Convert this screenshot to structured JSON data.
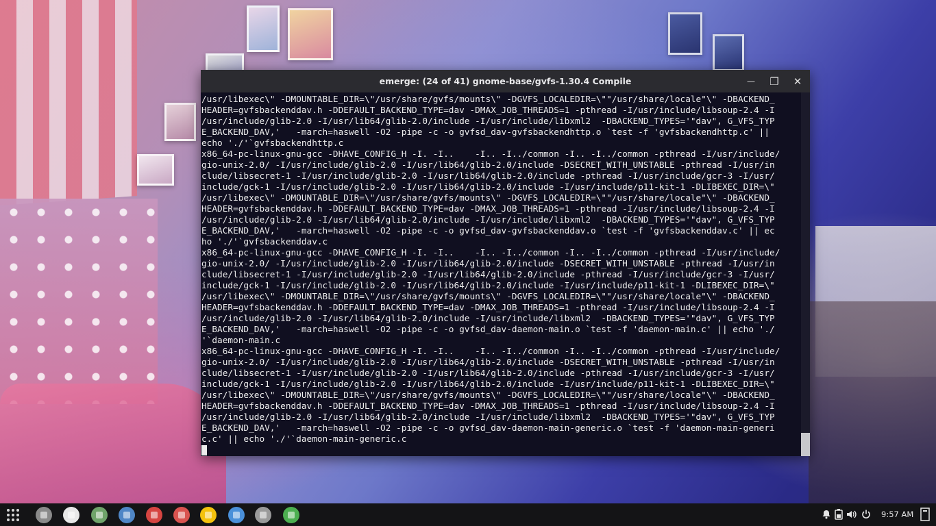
{
  "window": {
    "title": "emerge: (24 of 41) gnome-base/gvfs-1.30.4 Compile",
    "minimize_glyph": "—",
    "maximize_glyph": "❐",
    "close_glyph": "✕"
  },
  "terminal": {
    "lines": [
      "/usr/libexec\\\" -DMOUNTABLE_DIR=\\\"/usr/share/gvfs/mounts\\\" -DGVFS_LOCALEDIR=\\\"\"/usr/share/locale\"\\\" -DBACKEND_",
      "HEADER=gvfsbackenddav.h -DDEFAULT_BACKEND_TYPE=dav -DMAX_JOB_THREADS=1 -pthread -I/usr/include/libsoup-2.4 -I",
      "/usr/include/glib-2.0 -I/usr/lib64/glib-2.0/include -I/usr/include/libxml2  -DBACKEND_TYPES='\"dav\", G_VFS_TYP",
      "E_BACKEND_DAV,'   -march=haswell -O2 -pipe -c -o gvfsd_dav-gvfsbackendhttp.o `test -f 'gvfsbackendhttp.c' ||",
      "echo './'`gvfsbackendhttp.c",
      "x86_64-pc-linux-gnu-gcc -DHAVE_CONFIG_H -I. -I..    -I.. -I../common -I.. -I../common -pthread -I/usr/include/",
      "gio-unix-2.0/ -I/usr/include/glib-2.0 -I/usr/lib64/glib-2.0/include -DSECRET_WITH_UNSTABLE -pthread -I/usr/in",
      "clude/libsecret-1 -I/usr/include/glib-2.0 -I/usr/lib64/glib-2.0/include -pthread -I/usr/include/gcr-3 -I/usr/",
      "include/gck-1 -I/usr/include/glib-2.0 -I/usr/lib64/glib-2.0/include -I/usr/include/p11-kit-1 -DLIBEXEC_DIR=\\\"",
      "/usr/libexec\\\" -DMOUNTABLE_DIR=\\\"/usr/share/gvfs/mounts\\\" -DGVFS_LOCALEDIR=\\\"\"/usr/share/locale\"\\\" -DBACKEND_",
      "HEADER=gvfsbackenddav.h -DDEFAULT_BACKEND_TYPE=dav -DMAX_JOB_THREADS=1 -pthread -I/usr/include/libsoup-2.4 -I",
      "/usr/include/glib-2.0 -I/usr/lib64/glib-2.0/include -I/usr/include/libxml2  -DBACKEND_TYPES='\"dav\", G_VFS_TYP",
      "E_BACKEND_DAV,'   -march=haswell -O2 -pipe -c -o gvfsd_dav-gvfsbackenddav.o `test -f 'gvfsbackenddav.c' || ec",
      "ho './'`gvfsbackenddav.c",
      "x86_64-pc-linux-gnu-gcc -DHAVE_CONFIG_H -I. -I..    -I.. -I../common -I.. -I../common -pthread -I/usr/include/",
      "gio-unix-2.0/ -I/usr/include/glib-2.0 -I/usr/lib64/glib-2.0/include -DSECRET_WITH_UNSTABLE -pthread -I/usr/in",
      "clude/libsecret-1 -I/usr/include/glib-2.0 -I/usr/lib64/glib-2.0/include -pthread -I/usr/include/gcr-3 -I/usr/",
      "include/gck-1 -I/usr/include/glib-2.0 -I/usr/lib64/glib-2.0/include -I/usr/include/p11-kit-1 -DLIBEXEC_DIR=\\\"",
      "/usr/libexec\\\" -DMOUNTABLE_DIR=\\\"/usr/share/gvfs/mounts\\\" -DGVFS_LOCALEDIR=\\\"\"/usr/share/locale\"\\\" -DBACKEND_",
      "HEADER=gvfsbackenddav.h -DDEFAULT_BACKEND_TYPE=dav -DMAX_JOB_THREADS=1 -pthread -I/usr/include/libsoup-2.4 -I",
      "/usr/include/glib-2.0 -I/usr/lib64/glib-2.0/include -I/usr/include/libxml2  -DBACKEND_TYPES='\"dav\", G_VFS_TYP",
      "E_BACKEND_DAV,'   -march=haswell -O2 -pipe -c -o gvfsd_dav-daemon-main.o `test -f 'daemon-main.c' || echo './",
      "'`daemon-main.c",
      "x86_64-pc-linux-gnu-gcc -DHAVE_CONFIG_H -I. -I..    -I.. -I../common -I.. -I../common -pthread -I/usr/include/",
      "gio-unix-2.0/ -I/usr/include/glib-2.0 -I/usr/lib64/glib-2.0/include -DSECRET_WITH_UNSTABLE -pthread -I/usr/in",
      "clude/libsecret-1 -I/usr/include/glib-2.0 -I/usr/lib64/glib-2.0/include -pthread -I/usr/include/gcr-3 -I/usr/",
      "include/gck-1 -I/usr/include/glib-2.0 -I/usr/lib64/glib-2.0/include -I/usr/include/p11-kit-1 -DLIBEXEC_DIR=\\\"",
      "/usr/libexec\\\" -DMOUNTABLE_DIR=\\\"/usr/share/gvfs/mounts\\\" -DGVFS_LOCALEDIR=\\\"\"/usr/share/locale\"\\\" -DBACKEND_",
      "HEADER=gvfsbackenddav.h -DDEFAULT_BACKEND_TYPE=dav -DMAX_JOB_THREADS=1 -pthread -I/usr/include/libsoup-2.4 -I",
      "/usr/include/glib-2.0 -I/usr/lib64/glib-2.0/include -I/usr/include/libxml2  -DBACKEND_TYPES='\"dav\", G_VFS_TYP",
      "E_BACKEND_DAV,'   -march=haswell -O2 -pipe -c -o gvfsd_dav-daemon-main-generic.o `test -f 'daemon-main-generi",
      "c.c' || echo './'`daemon-main-generic.c"
    ]
  },
  "shelf": {
    "apps": [
      {
        "icon": "files-icon",
        "color": "#8a8a8a"
      },
      {
        "icon": "terminal-app-icon",
        "color": "#e8e8e8"
      },
      {
        "icon": "toggle-app-icon",
        "color": "#6fa36a"
      },
      {
        "icon": "settings-tools-icon",
        "color": "#4f86c6"
      },
      {
        "icon": "text-editor-icon",
        "color": "#d64541"
      },
      {
        "icon": "power-app-icon",
        "color": "#d9534f"
      },
      {
        "icon": "chrome-icon",
        "color": "#f4c20d"
      },
      {
        "icon": "document-icon",
        "color": "#4a90d9"
      },
      {
        "icon": "image-viewer-icon",
        "color": "#9a9a9a"
      },
      {
        "icon": "spreadsheet-icon",
        "color": "#4caf50"
      }
    ],
    "tray": {
      "notification_icon": "bell-icon",
      "battery_icon": "battery-icon",
      "volume_icon": "volume-icon",
      "power_icon": "power-icon"
    },
    "clock": "9:57 AM"
  },
  "colors": {
    "terminal_bg": "#100f20",
    "terminal_fg": "#ededed",
    "titlebar_bg": "#2b2b30",
    "shelf_bg": "#141416"
  }
}
